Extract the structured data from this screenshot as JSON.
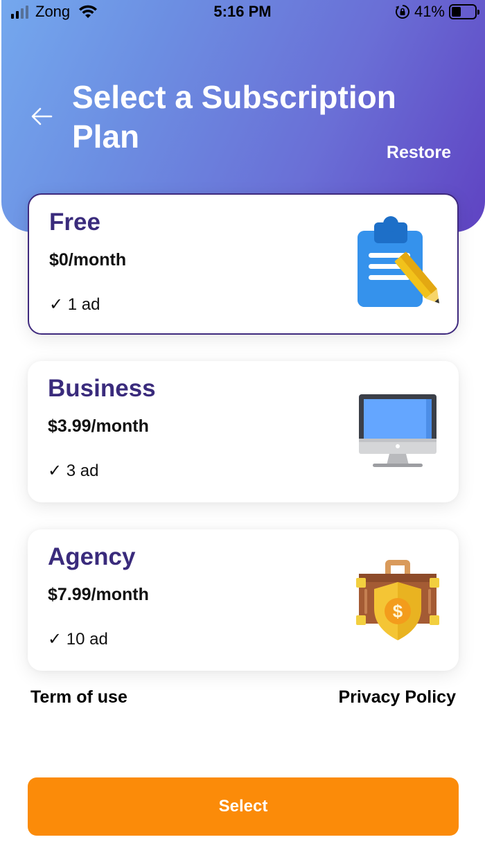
{
  "status_bar": {
    "carrier": "Zong",
    "time": "5:16 PM",
    "battery": "41%",
    "battery_level": 0.41,
    "signal_bars": 2
  },
  "header": {
    "title": "Select a Subscription Plan",
    "restore_label": "Restore",
    "gradient": [
      "#74a8ee",
      "#5f43c2"
    ]
  },
  "plans": [
    {
      "name": "Free",
      "price": "$0/month",
      "feature": "✓ 1 ad",
      "icon": "clipboard-pencil-icon",
      "selected": true
    },
    {
      "name": "Business",
      "price": "$3.99/month",
      "feature": "✓ 3 ad",
      "icon": "monitor-icon",
      "selected": false
    },
    {
      "name": "Agency",
      "price": "$7.99/month",
      "feature": "✓ 10 ad",
      "icon": "briefcase-shield-dollar-icon",
      "selected": false
    }
  ],
  "footer": {
    "terms_label": "Term of use",
    "privacy_label": "Privacy Policy",
    "select_label": "Select"
  },
  "colors": {
    "accent": "#fb8b09",
    "plan_title": "#3a2b7c",
    "selected_border": "#3f2a7e"
  }
}
